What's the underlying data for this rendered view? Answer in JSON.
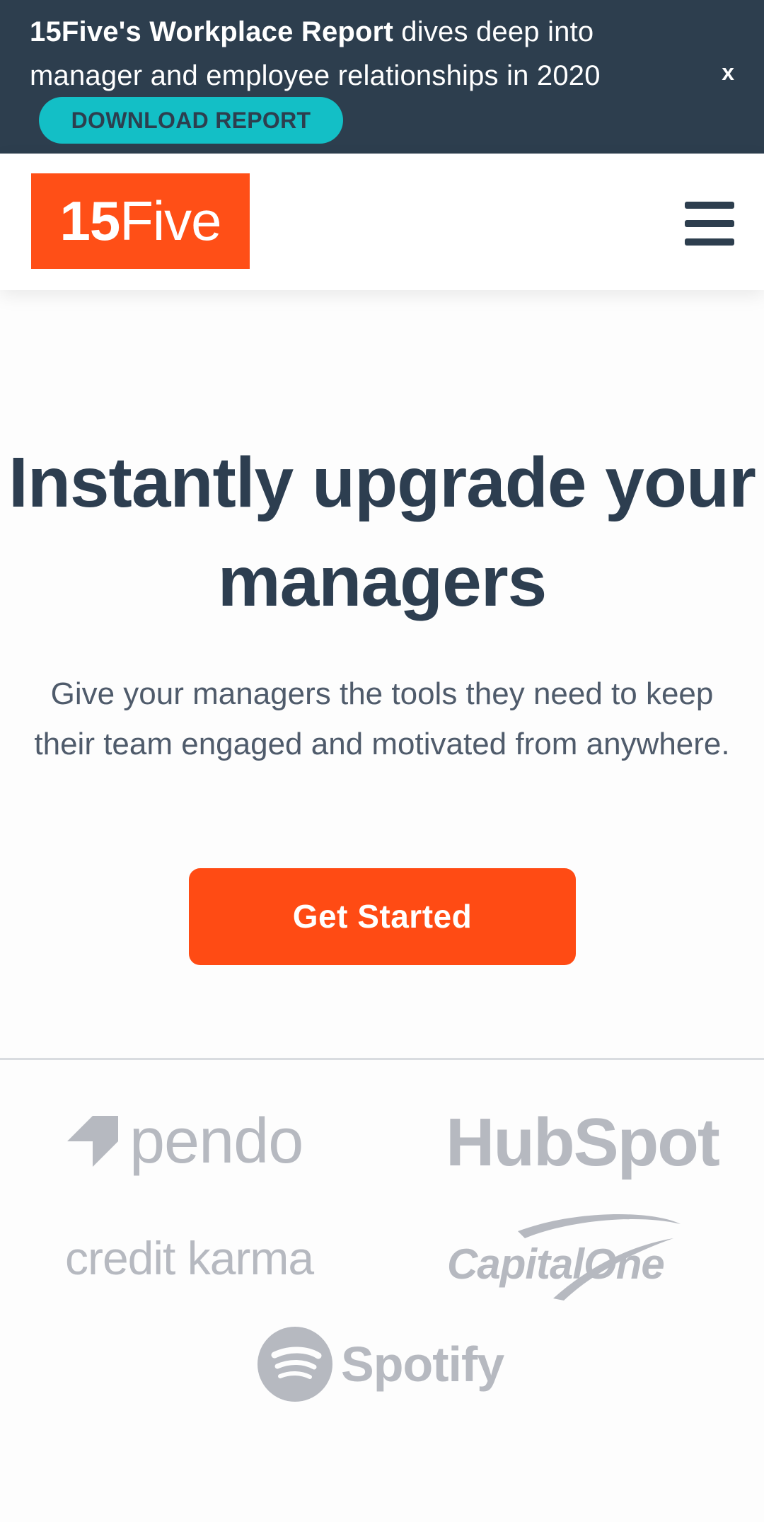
{
  "promo": {
    "bold_text": "15Five's Workplace Report",
    "text": " dives deep into manager and employee relationships in 2020",
    "close_label": "x",
    "button_label": "DOWNLOAD REPORT"
  },
  "header": {
    "logo_number": "15",
    "logo_word": "Five",
    "menu_icon": "hamburger-menu-icon"
  },
  "hero": {
    "title": "Instantly upgrade your managers",
    "subtitle": "Give your managers the tools they need to keep their team engaged and motivated from anywhere.",
    "cta_label": "Get Started"
  },
  "customers": {
    "pendo": "pendo",
    "hubspot": "HubSpot",
    "creditkarma": "credit karma",
    "capitalone": "CapitalOne",
    "spotify": "Spotify"
  },
  "colors": {
    "promo_bg": "#2d3e4e",
    "promo_button": "#13bfc6",
    "brand_orange": "#ff4f17",
    "cta": "#ff4b14",
    "logo_gray": "#b6b9c0"
  }
}
